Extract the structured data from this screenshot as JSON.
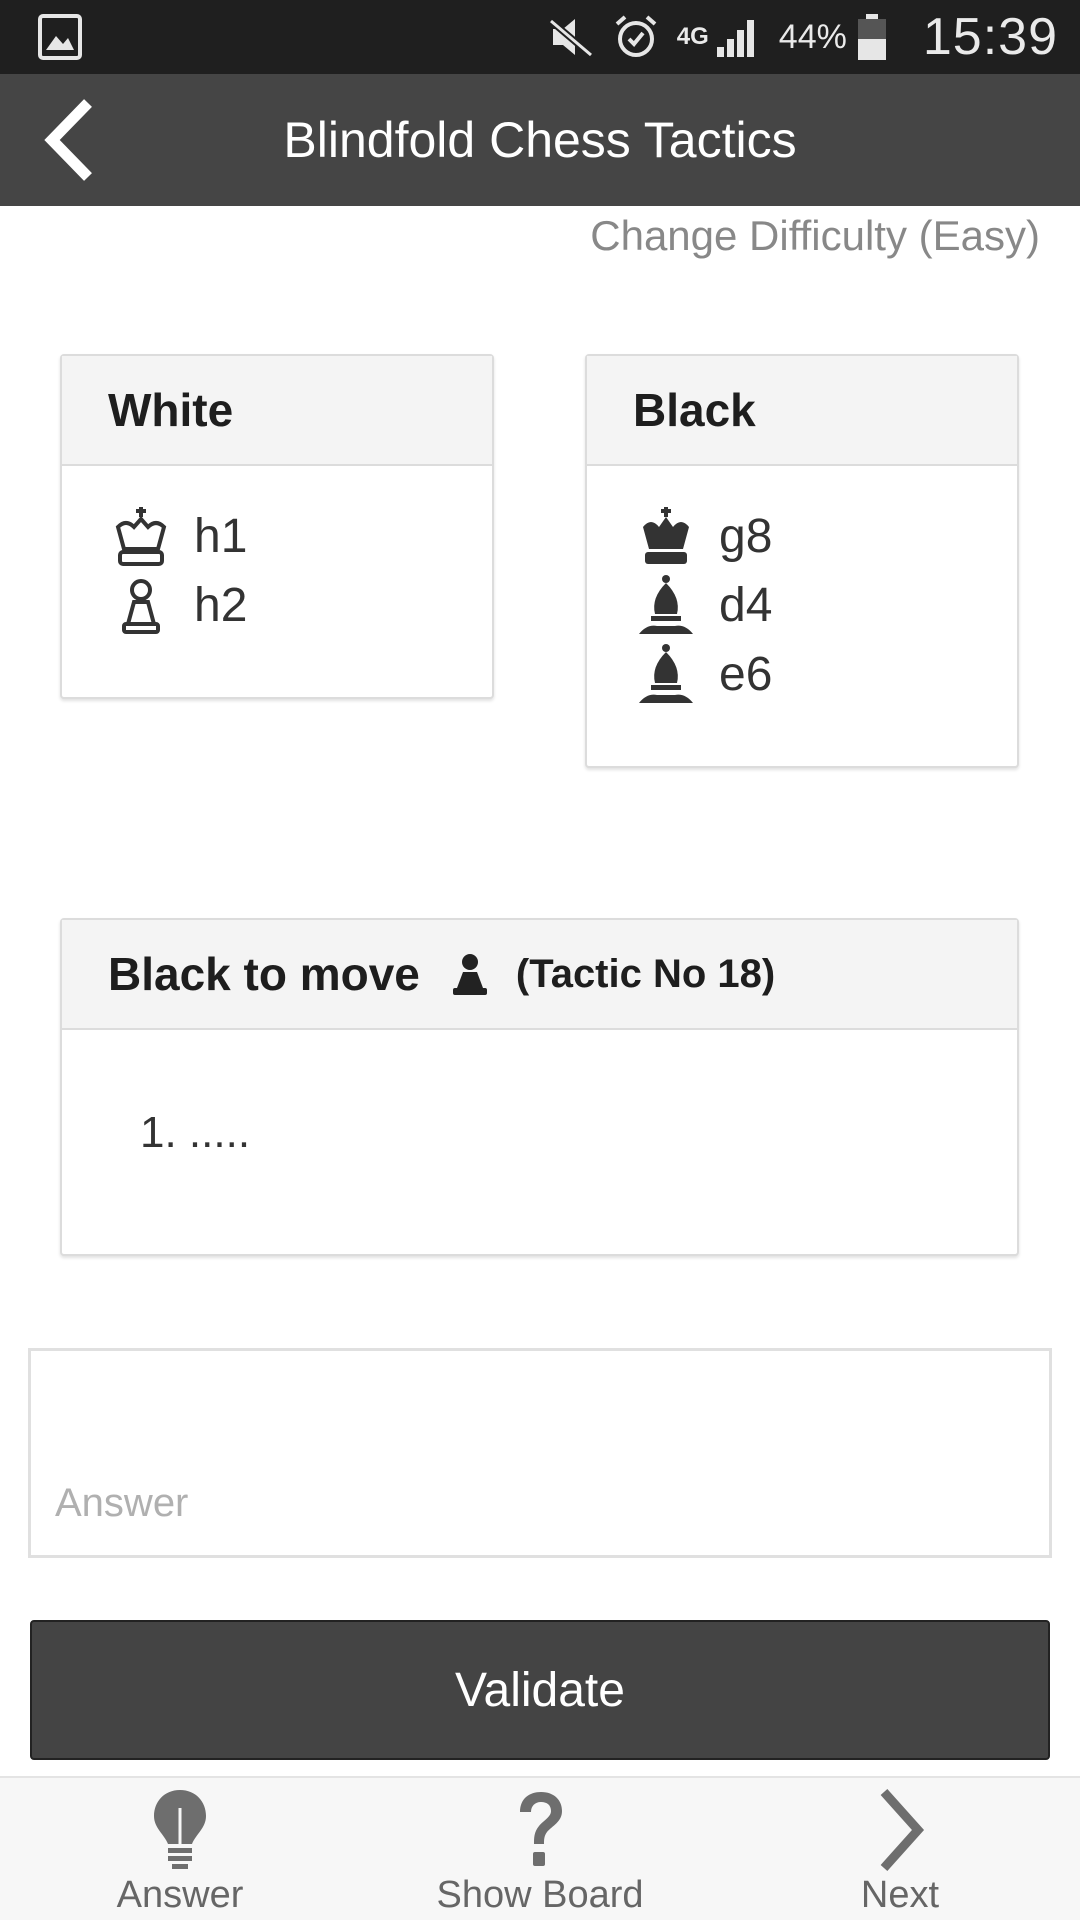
{
  "status_bar": {
    "network": "4G",
    "battery_percent": "44%",
    "battery_level": 0.44,
    "time": "15:39",
    "icons": [
      "gallery-icon",
      "mute-icon",
      "alarm-icon",
      "signal-icon",
      "battery-icon"
    ]
  },
  "action_bar": {
    "title": "Blindfold Chess Tactics",
    "back_icon": "chevron-left-icon"
  },
  "difficulty_link": "Change Difficulty (Easy)",
  "white": {
    "title": "White",
    "pieces": [
      {
        "piece": "king",
        "square": "h1"
      },
      {
        "piece": "pawn",
        "square": "h2"
      }
    ]
  },
  "black": {
    "title": "Black",
    "pieces": [
      {
        "piece": "king",
        "square": "g8"
      },
      {
        "piece": "bishop",
        "square": "d4"
      },
      {
        "piece": "bishop",
        "square": "e6"
      }
    ]
  },
  "move_card": {
    "title": "Black to move",
    "tactic": "(Tactic No 18)",
    "line": "1. ....."
  },
  "answer": {
    "value": "",
    "placeholder": "Answer"
  },
  "validate_label": "Validate",
  "bottom_nav": {
    "answer_label": "Answer",
    "board_label": "Show Board",
    "next_label": "Next"
  },
  "colors": {
    "status_bar": "#1f1f1f",
    "action_bar": "#454545",
    "button": "#444444",
    "card_header": "#f4f4f4"
  }
}
